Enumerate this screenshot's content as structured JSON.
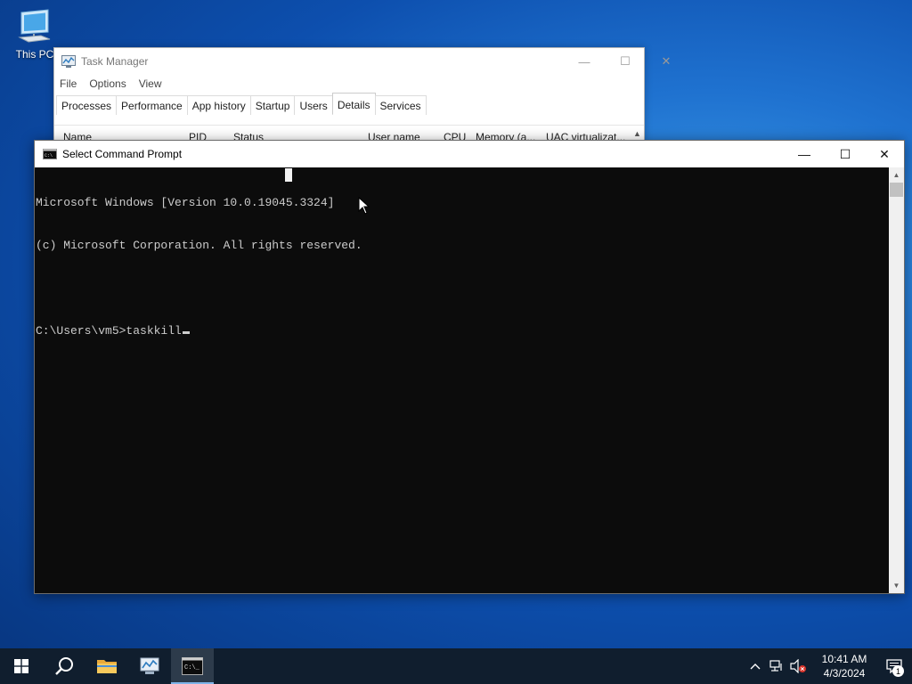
{
  "desktop": {
    "icons": [
      {
        "label": "This PC",
        "icon": "this-pc-icon"
      }
    ]
  },
  "task_manager": {
    "title": "Task Manager",
    "menu": [
      "File",
      "Options",
      "View"
    ],
    "tabs": [
      "Processes",
      "Performance",
      "App history",
      "Startup",
      "Users",
      "Details",
      "Services"
    ],
    "active_tab": "Details",
    "columns": [
      "Name",
      "PID",
      "Status",
      "User name",
      "CPU",
      "Memory (a...",
      "UAC virtualizat..."
    ],
    "controls": {
      "minimize": "—",
      "maximize": "☐",
      "close": "✕"
    }
  },
  "command_prompt": {
    "title": "Select Command Prompt",
    "lines": [
      "Microsoft Windows [Version 10.0.19045.3324]",
      "(c) Microsoft Corporation. All rights reserved.",
      "",
      "C:\\Users\\vm5>taskkill"
    ],
    "controls": {
      "minimize": "—",
      "maximize": "☐",
      "close": "✕"
    }
  },
  "taskbar": {
    "pinned": [
      {
        "name": "start-button",
        "icon": "windows-logo-icon"
      },
      {
        "name": "search-button",
        "icon": "search-icon"
      },
      {
        "name": "file-explorer-button",
        "icon": "folder-icon"
      },
      {
        "name": "task-manager-button",
        "icon": "task-manager-icon"
      },
      {
        "name": "command-prompt-button",
        "icon": "command-prompt-icon",
        "active": true
      }
    ],
    "tray": {
      "time": "10:41 AM",
      "date": "4/3/2024",
      "notification_count": "1"
    }
  }
}
